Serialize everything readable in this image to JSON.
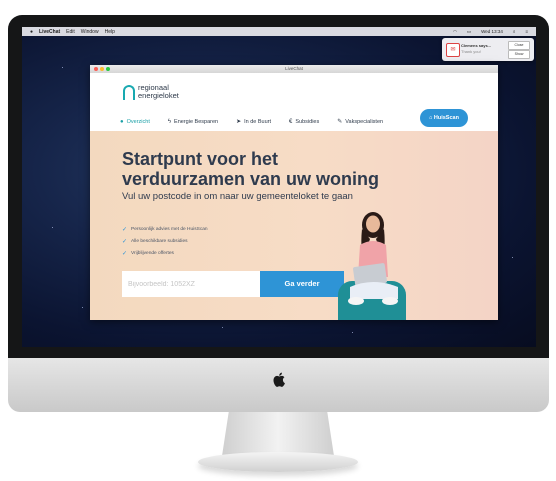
{
  "menubar": {
    "app": "LiveChat",
    "items": [
      "Edit",
      "Window",
      "Help"
    ],
    "clock": "Wed 13:34"
  },
  "notification": {
    "title": "Clemens says...",
    "subtitle": "Thank you!",
    "close_label": "Close",
    "show_label": "Show"
  },
  "window": {
    "title": "LiveChat"
  },
  "site": {
    "logo_line1": "regionaal",
    "logo_line2": "energieloket",
    "nav": [
      {
        "label": "Overzicht",
        "icon": "globe-icon"
      },
      {
        "label": "Energie Besparen",
        "icon": "lightning-icon"
      },
      {
        "label": "In de Buurt",
        "icon": "location-arrow-icon"
      },
      {
        "label": "Subsidies",
        "icon": "euro-icon"
      },
      {
        "label": "Vakspecialisten",
        "icon": "wrench-icon"
      }
    ],
    "cta_button": "HuisScan",
    "hero_title": "Startpunt voor het verduurzamen van uw woning",
    "hero_subtitle": "Vul uw postcode in om naar uw gemeenteloket te gaan",
    "checks": [
      "Persoonlijk advies met de HuisScan",
      "Alle beschikbare subsidies",
      "Vrijblijvende offertes"
    ],
    "postcode_placeholder": "Bijvoorbeeld: 1052XZ",
    "submit_button": "Ga verder"
  },
  "colors": {
    "accent_teal": "#1aa0a7",
    "button_blue": "#2e94d6",
    "hero_bg": "#f3d9bf",
    "text_dark": "#2f3b4e"
  }
}
